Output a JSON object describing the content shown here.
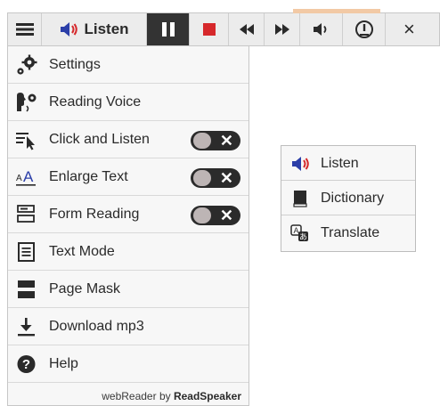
{
  "toolbar": {
    "listen_label": "Listen",
    "close_label": "×",
    "accent_color": "#f2c9a5",
    "listen_icon_color": "#2b3ea8",
    "stop_color": "#d6282b"
  },
  "menu": {
    "items": [
      {
        "label": "Settings",
        "icon": "gears-icon"
      },
      {
        "label": "Reading Voice",
        "icon": "voice-settings-icon"
      },
      {
        "label": "Click and Listen",
        "icon": "click-listen-icon",
        "toggle": "off"
      },
      {
        "label": "Enlarge Text",
        "icon": "enlarge-text-icon",
        "toggle": "off"
      },
      {
        "label": "Form Reading",
        "icon": "form-reading-icon",
        "toggle": "off"
      },
      {
        "label": "Text Mode",
        "icon": "text-mode-icon"
      },
      {
        "label": "Page Mask",
        "icon": "page-mask-icon"
      },
      {
        "label": "Download mp3",
        "icon": "download-icon"
      },
      {
        "label": "Help",
        "icon": "help-icon"
      }
    ],
    "toggle_symbol": "✕",
    "footer_prefix": "webReader by ",
    "footer_brand": "ReadSpeaker"
  },
  "popup": {
    "items": [
      {
        "label": "Listen",
        "icon": "speaker-icon"
      },
      {
        "label": "Dictionary",
        "icon": "book-icon"
      },
      {
        "label": "Translate",
        "icon": "translate-icon"
      }
    ]
  }
}
